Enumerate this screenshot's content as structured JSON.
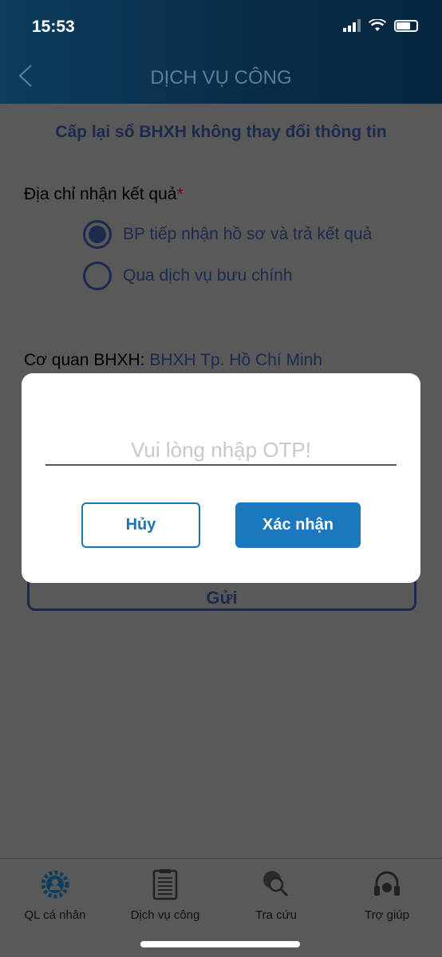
{
  "status_bar": {
    "time": "15:53"
  },
  "header": {
    "title": "DỊCH VỤ CÔNG"
  },
  "form": {
    "title": "Cấp lại sổ BHXH không thay đổi thông tin",
    "address_label": "Địa chỉ nhận kết quả",
    "required_mark": "*",
    "options": [
      {
        "label": "BP tiếp nhận hồ sơ và trả kết quả",
        "selected": true
      },
      {
        "label": "Qua dịch vụ bưu chính",
        "selected": false
      }
    ],
    "agency_label": "Cơ quan BHXH:",
    "agency_value": "BHXH Tp. Hồ Chí Minh",
    "submit_label": "Gửi"
  },
  "modal": {
    "otp_placeholder": "Vui lòng nhập OTP!",
    "otp_value": "",
    "cancel_label": "Hủy",
    "confirm_label": "Xác nhận"
  },
  "tabbar": {
    "items": [
      {
        "label": "QL cá nhân",
        "icon": "user-gear-icon"
      },
      {
        "label": "Dịch vụ công",
        "icon": "clipboard-icon"
      },
      {
        "label": "Tra cứu",
        "icon": "globe-search-icon"
      },
      {
        "label": "Trợ giúp",
        "icon": "headset-icon"
      }
    ]
  }
}
